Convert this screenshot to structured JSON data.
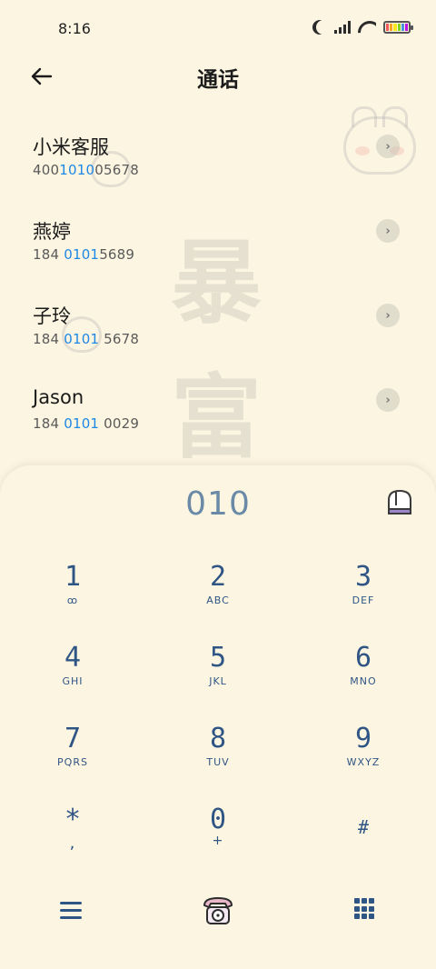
{
  "status_bar": {
    "time": "8:16",
    "battery_colors": [
      "#f25b5b",
      "#f5a623",
      "#f8e71c",
      "#7ed321",
      "#4a90e2",
      "#bd10e0"
    ]
  },
  "header": {
    "title": "通话",
    "back_icon": "arrow-left-icon"
  },
  "contacts": [
    {
      "name": "小米客服",
      "number_pre": "400",
      "number_match": "1010",
      "number_post": "05678"
    },
    {
      "name": "燕婷",
      "number_pre": "184 ",
      "number_match": "0101",
      "number_post": "5689"
    },
    {
      "name": "子玲",
      "number_pre": "184 ",
      "number_match": "0101",
      "number_post": " 5678"
    },
    {
      "name": "Jason",
      "number_pre": "184 ",
      "number_match": "0101",
      "number_post": " 0029"
    }
  ],
  "dialer": {
    "display": "010",
    "keys": [
      {
        "digit": "1",
        "letters": "ꝏ"
      },
      {
        "digit": "2",
        "letters": "ABC"
      },
      {
        "digit": "3",
        "letters": "DEF"
      },
      {
        "digit": "4",
        "letters": "GHI"
      },
      {
        "digit": "5",
        "letters": "JKL"
      },
      {
        "digit": "6",
        "letters": "MNO"
      },
      {
        "digit": "7",
        "letters": "PQRS"
      },
      {
        "digit": "8",
        "letters": "TUV"
      },
      {
        "digit": "9",
        "letters": "WXYZ"
      },
      {
        "digit": "*",
        "letters": ","
      },
      {
        "digit": "0",
        "letters": "+"
      },
      {
        "digit": "#",
        "letters": ""
      }
    ]
  },
  "watermark": [
    "暴",
    "富",
    "暴",
    "富"
  ],
  "colors": {
    "background": "#fcf5e1",
    "highlight": "#1e88e5",
    "keypad_text": "#2f5585",
    "display_text": "#6b8aa7"
  }
}
